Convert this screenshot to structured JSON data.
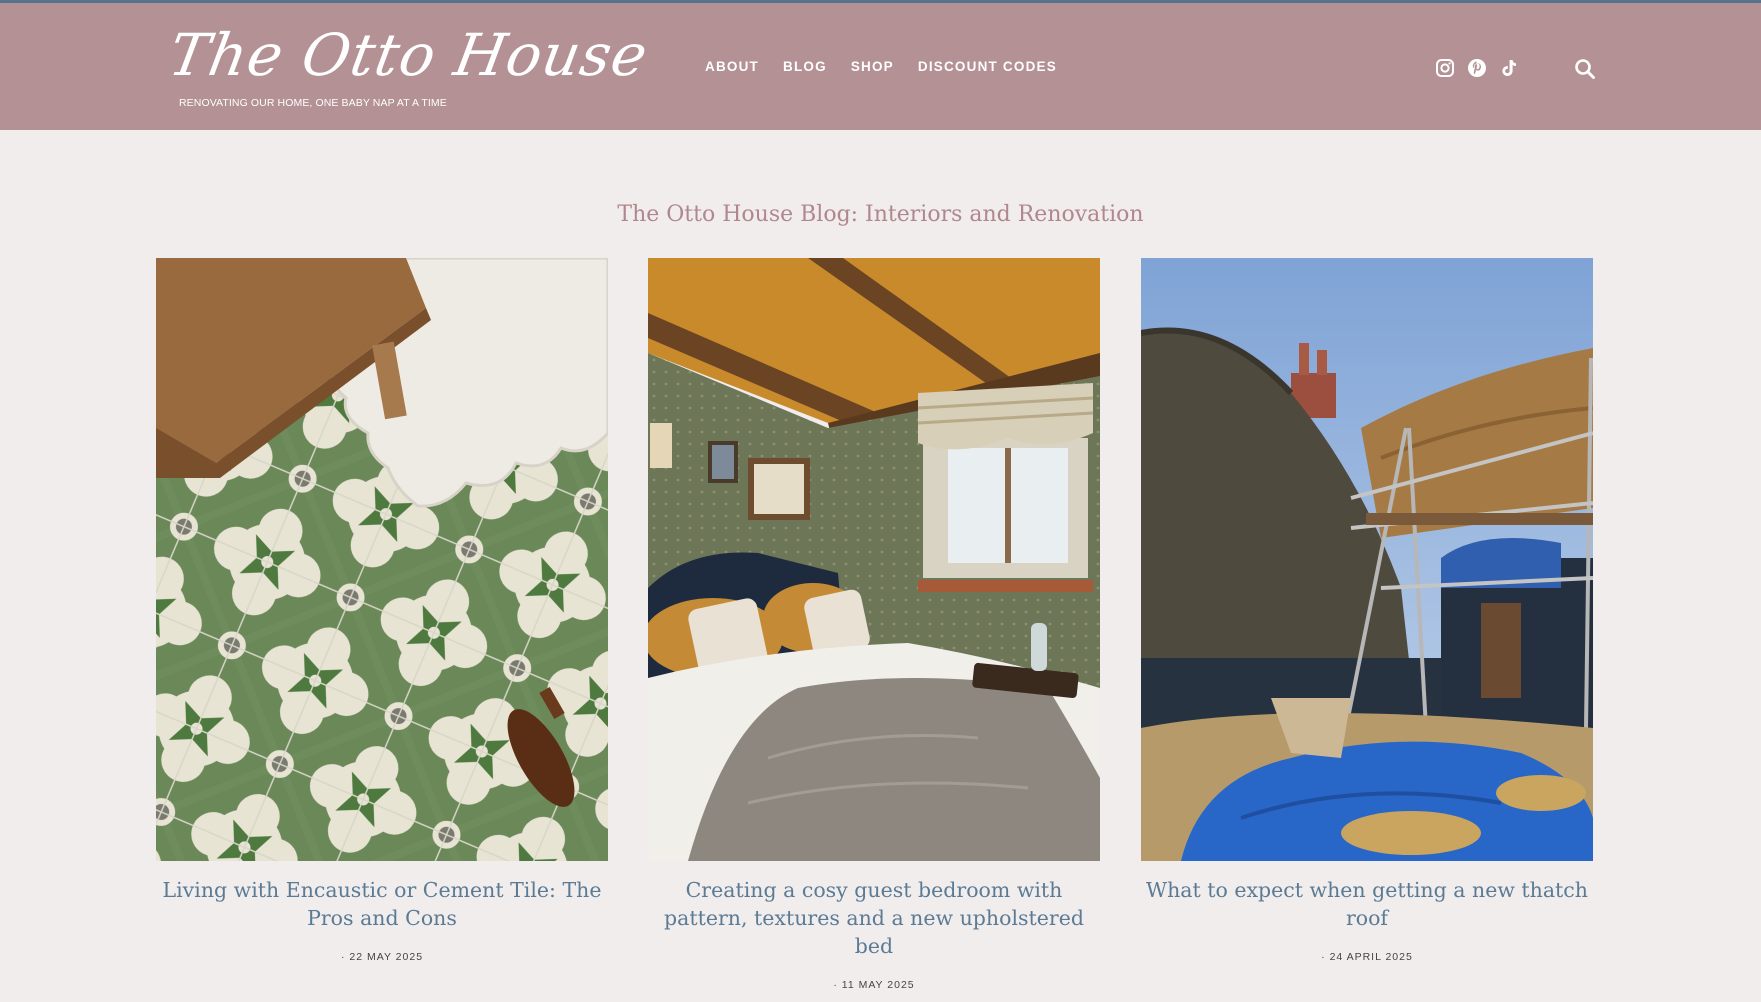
{
  "colors": {
    "header_bg": "#b39195",
    "page_bg": "#f1eded",
    "top_border": "#56738a",
    "title_color": "#b0878c",
    "post_title_color": "#5b7b95"
  },
  "header": {
    "logo_text": "The Otto House",
    "tagline": "RENOVATING OUR HOME, ONE BABY NAP AT A TIME",
    "nav": [
      {
        "label": "ABOUT"
      },
      {
        "label": "BLOG"
      },
      {
        "label": "SHOP"
      },
      {
        "label": "DISCOUNT CODES"
      }
    ],
    "social_icons": [
      "instagram-icon",
      "pinterest-icon",
      "tiktok-icon"
    ],
    "search_icon": "search-icon"
  },
  "main": {
    "title": "The Otto House Blog: Interiors and Renovation",
    "posts": [
      {
        "title": "Living with Encaustic or Cement Tile: The Pros and Cons",
        "date": "22 MAY 2025"
      },
      {
        "title": "Creating a cosy guest bedroom with pattern, textures and a new upholstered bed",
        "date": "11 MAY 2025"
      },
      {
        "title": "What to expect when getting a new thatch roof",
        "date": "24 APRIL 2025"
      }
    ]
  }
}
